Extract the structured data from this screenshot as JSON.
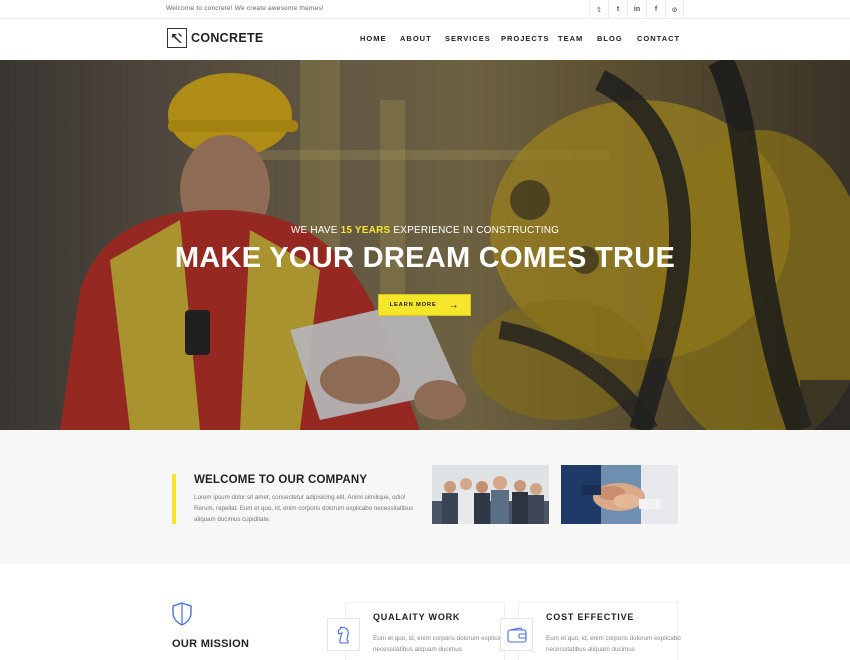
{
  "topbar": {
    "tagline": "Welcome to concrete! We create awesome themes!",
    "socials": [
      {
        "icon": "twitter-icon",
        "glyph": "𝕥"
      },
      {
        "icon": "tumblr-icon",
        "glyph": "t"
      },
      {
        "icon": "linkedin-icon",
        "glyph": "in"
      },
      {
        "icon": "facebook-icon",
        "glyph": "f"
      },
      {
        "icon": "pinterest-icon",
        "glyph": "⊙"
      }
    ]
  },
  "header": {
    "logo_text": "CONCRETE",
    "nav": [
      "HOME",
      "ABOUT",
      "SERVICES",
      "PROJECTS",
      "TEAM",
      "BLOG",
      "CONTACT"
    ]
  },
  "hero": {
    "sub_before": "WE HAVE",
    "sub_highlight": "15 YEARS",
    "sub_after": "EXPERIENCE IN CONSTRUCTING",
    "title": "MAKE YOUR DREAM COMES TRUE",
    "button": "LEARN MORE",
    "accent": "#f5e52d"
  },
  "welcome": {
    "title": "WELCOME TO OUR COMPANY",
    "text": "Lorem ipsum dolor sit amet, consectetur adipisicing elit. Animi similique, odio! Rerum, repellat. Eum et quo, id, enim corporis dolorum explicabo necessitatibus aliquam ducimus cupiditate."
  },
  "mission": {
    "title": "OUR MISSION"
  },
  "features": [
    {
      "title": "QUALAITY WORK",
      "icon": "chess-knight-icon",
      "text": "Eum et quo, id, enim corporis dolorum explicabo necessitatibus aliquam ducimus"
    },
    {
      "title": "COST EFFECTIVE",
      "icon": "wallet-icon",
      "text": "Eum et quo, id, enim corporis dolorum explicabo necessitatibus aliquam ducimus"
    }
  ]
}
